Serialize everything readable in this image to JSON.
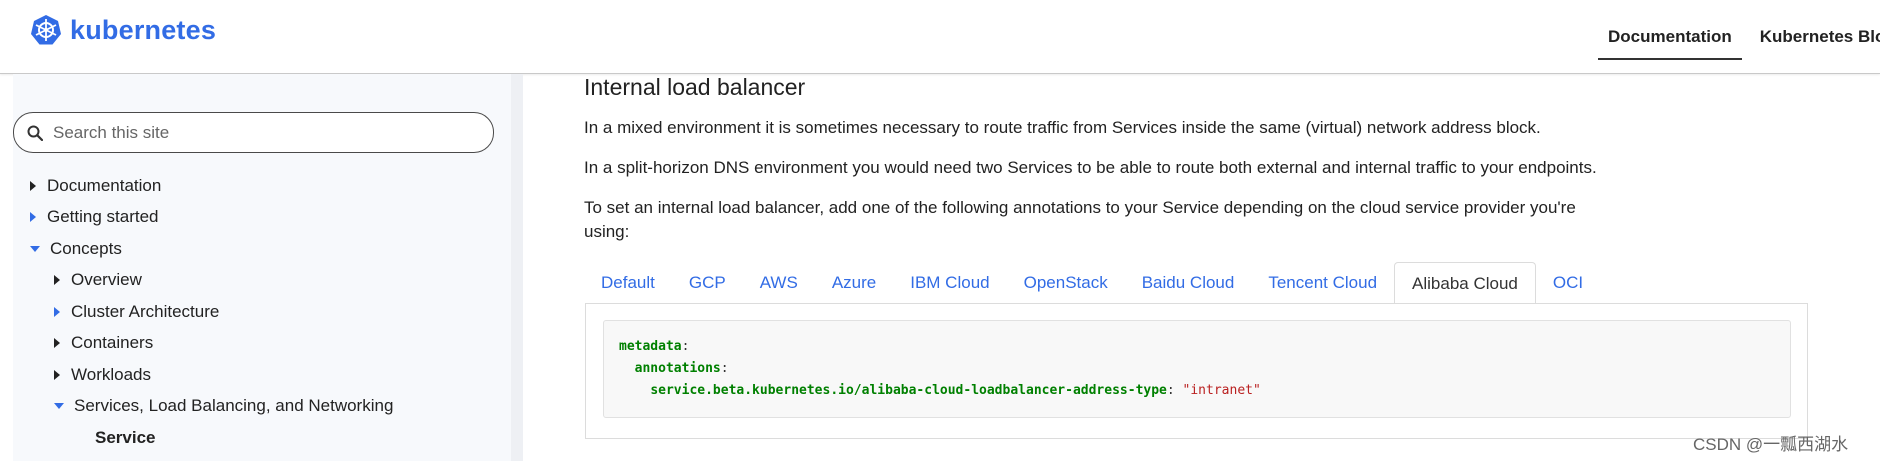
{
  "header": {
    "logo_text": "kubernetes",
    "nav": [
      {
        "label": "Documentation",
        "active": true
      },
      {
        "label": "Kubernetes Blog"
      }
    ]
  },
  "sidebar": {
    "search_placeholder": "Search this site",
    "items": [
      {
        "label": "Documentation",
        "level": 0,
        "state": "collapsed"
      },
      {
        "label": "Getting started",
        "level": 0,
        "state": "collapsed"
      },
      {
        "label": "Concepts",
        "level": 0,
        "state": "expanded"
      },
      {
        "label": "Overview",
        "level": 1,
        "state": "collapsed"
      },
      {
        "label": "Cluster Architecture",
        "level": 1,
        "state": "collapsed"
      },
      {
        "label": "Containers",
        "level": 1,
        "state": "collapsed"
      },
      {
        "label": "Workloads",
        "level": 1,
        "state": "collapsed"
      },
      {
        "label": "Services, Load Balancing, and Networking",
        "level": 1,
        "state": "expanded"
      },
      {
        "label": "Service",
        "level": 2,
        "state": "current"
      }
    ]
  },
  "main": {
    "heading": "Internal load balancer",
    "paragraphs": [
      "In a mixed environment it is sometimes necessary to route traffic from Services inside the same (virtual) network address block.",
      "In a split-horizon DNS environment you would need two Services to be able to route both external and internal traffic to your endpoints.",
      "To set an internal load balancer, add one of the following annotations to your Service depending on the cloud service provider you're using:"
    ],
    "tabs": [
      "Default",
      "GCP",
      "AWS",
      "Azure",
      "IBM Cloud",
      "OpenStack",
      "Baidu Cloud",
      "Tencent Cloud",
      "Alibaba Cloud",
      "OCI"
    ],
    "active_tab": "Alibaba Cloud",
    "code": {
      "line1_key": "metadata",
      "line2_key": "annotations",
      "line3_key": "service.beta.kubernetes.io/alibaba-cloud-loadbalancer-address-type",
      "line3_value": "\"intranet\""
    }
  },
  "watermark": "CSDN @一瓢西湖水",
  "colors": {
    "brand": "#326ce5",
    "yaml_key": "#008000",
    "yaml_string": "#ba2121"
  }
}
